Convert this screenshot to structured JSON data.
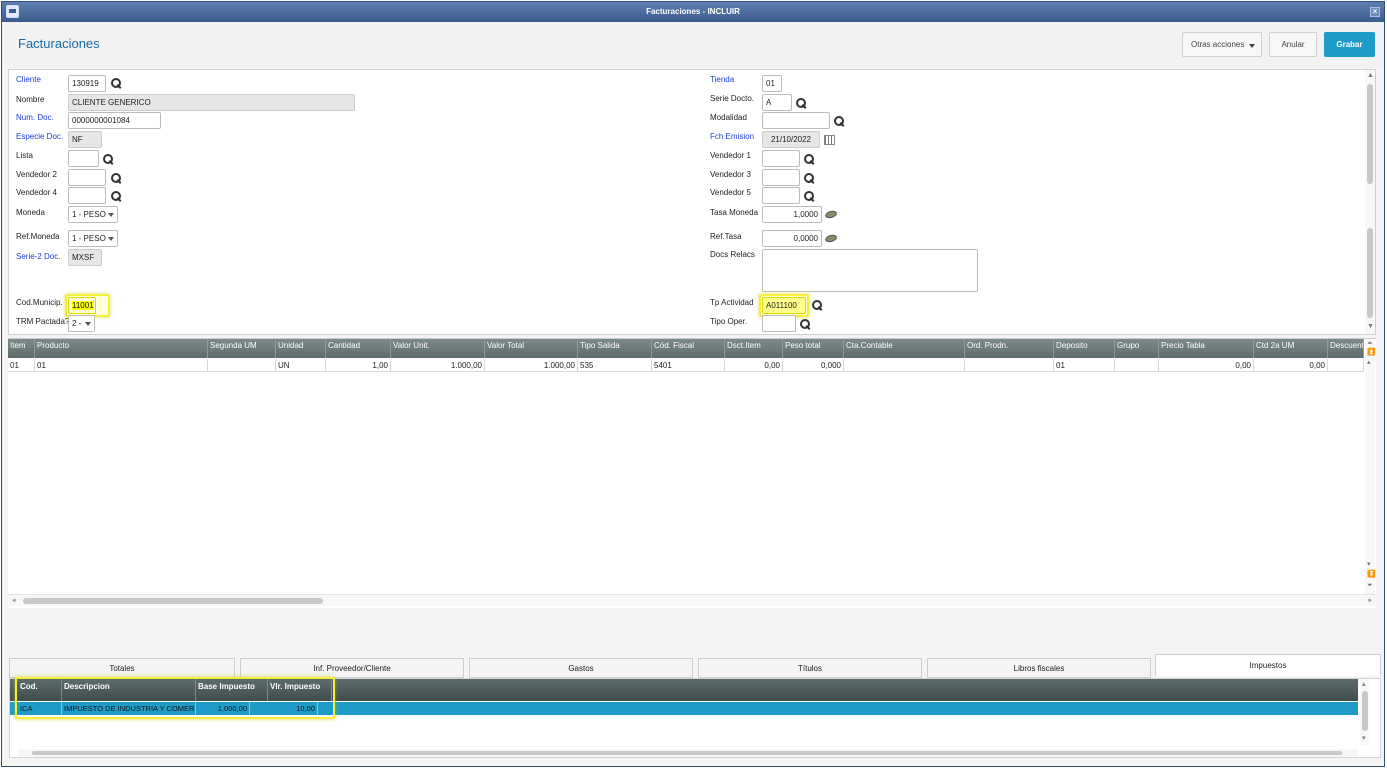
{
  "window": {
    "title": "Facturaciones - INCLUIR"
  },
  "header": {
    "page_title": "Facturaciones",
    "otras_acciones": "Otras acciones",
    "anular": "Anular",
    "grabar": "Grabar",
    "accent_color": "#1f9bc7"
  },
  "form": {
    "left": {
      "cliente": {
        "label": "Cliente",
        "value": "130919"
      },
      "nombre": {
        "label": "Nombre",
        "value": "CLIENTE GENERICO"
      },
      "num_doc": {
        "label": "Num. Doc.",
        "value": "0000000001084"
      },
      "especie_doc": {
        "label": "Especie Doc.",
        "value": "NF"
      },
      "lista": {
        "label": "Lista",
        "value": ""
      },
      "vendedor2": {
        "label": "Vendedor 2",
        "value": ""
      },
      "vendedor4": {
        "label": "Vendedor 4",
        "value": ""
      },
      "moneda": {
        "label": "Moneda",
        "value": "1 - PESO"
      },
      "ref_moneda": {
        "label": "Ref.Moneda",
        "value": "1 - PESO"
      },
      "serie2_doc": {
        "label": "Serie-2 Doc.",
        "value": "MXSF"
      },
      "cod_municip": {
        "label": "Cod.Municip.",
        "value": "11001"
      },
      "trm_pactada": {
        "label": "TRM Pactada?",
        "value": "2 -"
      }
    },
    "right": {
      "tienda": {
        "label": "Tienda",
        "value": "01"
      },
      "serie_docto": {
        "label": "Serie Docto.",
        "value": "A"
      },
      "modalidad": {
        "label": "Modalidad",
        "value": ""
      },
      "fch_emision": {
        "label": "Fch Emision",
        "value": "21/10/2022"
      },
      "vendedor1": {
        "label": "Vendedor 1",
        "value": ""
      },
      "vendedor3": {
        "label": "Vendedor 3",
        "value": ""
      },
      "vendedor5": {
        "label": "Vendedor 5",
        "value": ""
      },
      "tasa_moneda": {
        "label": "Tasa Moneda",
        "value": "1,0000"
      },
      "ref_tasa": {
        "label": "Ref.Tasa",
        "value": "0,0000"
      },
      "docs_relacs": {
        "label": "Docs Relacs",
        "value": ""
      },
      "tp_actividad": {
        "label": "Tp Actividad",
        "value": "A011100"
      },
      "tipo_oper": {
        "label": "Tipo Oper.",
        "value": ""
      }
    }
  },
  "items_grid": {
    "columns": [
      "Item",
      "Producto",
      "Segunda UM",
      "Unidad",
      "Cantidad",
      "Valor Unit.",
      "Valor Total",
      "Tipo Salida",
      "Cód. Fiscal",
      "Dsct.Item",
      "Peso total",
      "Cta.Contable",
      "Ord. Prodn.",
      "Deposito",
      "Grupo",
      "Precio Tabla",
      "Ctd 2a UM",
      "Descuent"
    ],
    "rows": [
      [
        "01",
        "01",
        "",
        "UN",
        "1,00",
        "1.000,00",
        "1.000,00",
        "535",
        "5401",
        "0,00",
        "0,000",
        "",
        "",
        "01",
        "",
        "0,00",
        "0,00",
        ""
      ]
    ]
  },
  "tabs": [
    "Totales",
    "Inf. Proveedor/Cliente",
    "Gastos",
    "Títulos",
    "Libros fiscales",
    "Impuestos"
  ],
  "taxes_grid": {
    "columns": [
      "Cod.",
      "Descripcion",
      "Base Impuesto",
      "Vlr. Impuesto"
    ],
    "rows": [
      [
        "ICA",
        "IMPUESTO DE INDUSTRIA Y COMERC",
        "1.000,00",
        "10,00"
      ]
    ]
  }
}
